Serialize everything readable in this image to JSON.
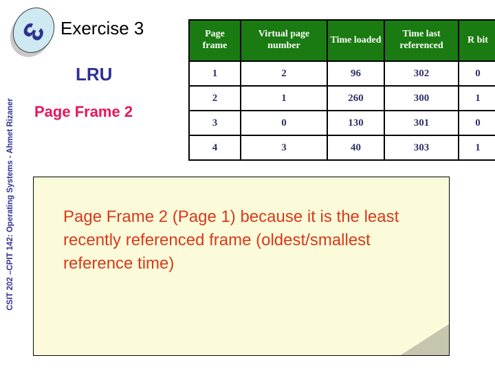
{
  "slide": {
    "badge_number": "3",
    "footer_vertical_text": "CSIT 202 –CPIT 142: Operating Systems - Ahmet Rizaner",
    "title": "Exercise 3",
    "algorithm_label": "LRU",
    "answer_label": "Page Frame 2",
    "explanation": "Page Frame 2 (Page 1) because it is the least recently referenced frame (oldest/smallest reference time)"
  },
  "colors": {
    "header_green": "#197b11",
    "table_text_navy": "#2e3168",
    "heading_navy": "#2e3192",
    "answer_pink": "#e8155c",
    "note_background": "#fbfbda",
    "note_text_red": "#d8391a",
    "badge_face": "#cfe9f2",
    "badge_shadow": "#c9c9c9"
  },
  "table": {
    "headers": [
      "Page frame",
      "Virtual page number",
      "Time loaded",
      "Time last referenced",
      "R bit"
    ],
    "rows": [
      {
        "frame": "1",
        "vpage": "2",
        "loaded": "96",
        "lastref": "302",
        "rbit": "0"
      },
      {
        "frame": "2",
        "vpage": "1",
        "loaded": "260",
        "lastref": "300",
        "rbit": "1"
      },
      {
        "frame": "3",
        "vpage": "0",
        "loaded": "130",
        "lastref": "301",
        "rbit": "0"
      },
      {
        "frame": "4",
        "vpage": "3",
        "loaded": "40",
        "lastref": "303",
        "rbit": "1"
      }
    ]
  }
}
